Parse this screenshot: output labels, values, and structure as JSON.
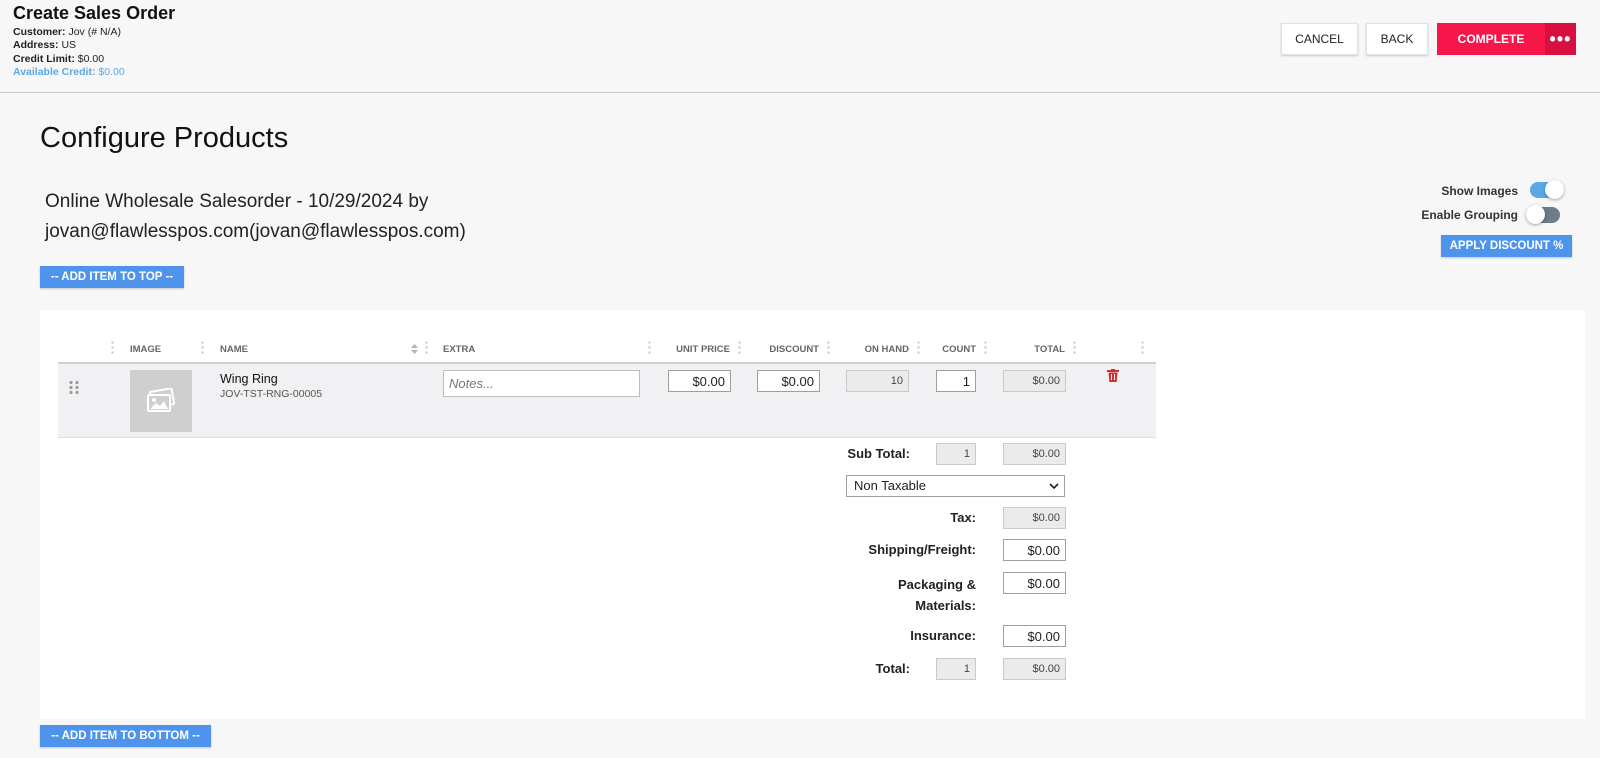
{
  "header": {
    "title": "Create Sales Order",
    "customer_label": "Customer:",
    "customer_value": "Jov (# N/A)",
    "address_label": "Address:",
    "address_value": "US",
    "credit_limit_label": "Credit Limit:",
    "credit_limit_value": "$0.00",
    "available_credit_label": "Available Credit:",
    "available_credit_value": "$0.00",
    "cancel_label": "CANCEL",
    "back_label": "BACK",
    "complete_label": "COMPLETE",
    "more_label": "•••"
  },
  "page": {
    "title": "Configure Products",
    "order_title_line1": "Online Wholesale Salesorder - 10/29/2024 by",
    "order_title_line2": "jovan@flawlesspos.com(jovan@flawlesspos.com)",
    "show_images_label": "Show Images",
    "show_images_on": true,
    "enable_grouping_label": "Enable Grouping",
    "enable_grouping_on": false,
    "apply_discount_label": "APPLY DISCOUNT %",
    "add_top_label": "-- ADD ITEM TO TOP --",
    "add_bottom_label": "-- ADD ITEM TO BOTTOM --"
  },
  "table": {
    "columns": [
      "IMAGE",
      "NAME",
      "EXTRA",
      "UNIT PRICE",
      "DISCOUNT",
      "ON HAND",
      "COUNT",
      "TOTAL"
    ],
    "rows": [
      {
        "name": "Wing Ring",
        "sku": "JOV-TST-RNG-00005",
        "notes_placeholder": "Notes...",
        "unit_price": "$0.00",
        "discount": "$0.00",
        "on_hand": "10",
        "count": "1",
        "total": "$0.00"
      }
    ]
  },
  "summary": {
    "subtotal_label": "Sub Total:",
    "subtotal_count": "1",
    "subtotal_amount": "$0.00",
    "tax_option": "Non Taxable",
    "tax_label": "Tax:",
    "tax_amount": "$0.00",
    "shipping_label": "Shipping/Freight:",
    "shipping_amount": "$0.00",
    "packaging_label_line1": "Packaging &",
    "packaging_label_line2": "Materials:",
    "packaging_amount": "$0.00",
    "insurance_label": "Insurance:",
    "insurance_amount": "$0.00",
    "total_label": "Total:",
    "total_count": "1",
    "total_amount": "$0.00"
  },
  "colors": {
    "accent_blue": "#4f94ec",
    "complete_red": "#f6164a",
    "toggle_on": "#5aa8e6",
    "delete_red": "#d32f2f"
  }
}
